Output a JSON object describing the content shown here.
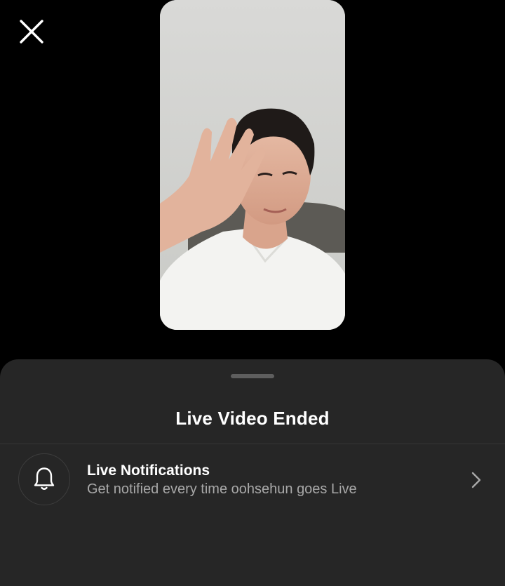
{
  "app": {
    "background_color": "#000000",
    "sheet_color": "#262626"
  },
  "header": {
    "close_icon": "close-icon"
  },
  "video": {
    "description_icon": "video-thumbnail"
  },
  "sheet": {
    "title": "Live Video Ended",
    "notification_row": {
      "icon": "bell-icon",
      "title": "Live Notifications",
      "subtitle": "Get notified every time oohsehun goes Live",
      "chevron_icon": "chevron-right-icon"
    }
  }
}
